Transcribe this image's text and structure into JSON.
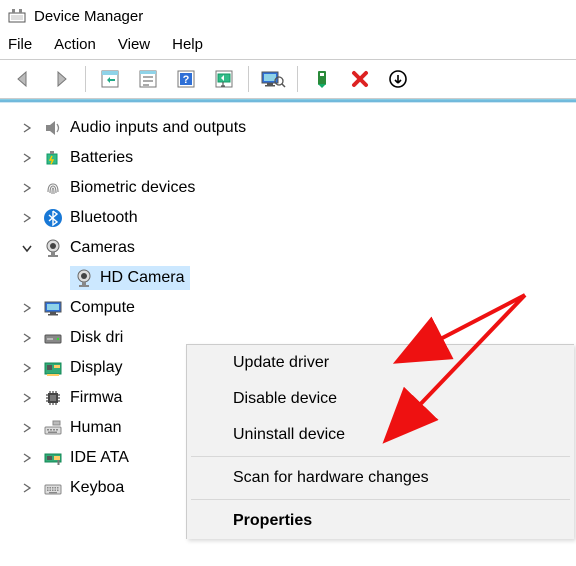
{
  "title": "Device Manager",
  "menu": {
    "file": "File",
    "action": "Action",
    "view": "View",
    "help": "Help"
  },
  "tree": {
    "audio": "Audio inputs and outputs",
    "batteries": "Batteries",
    "biometric": "Biometric devices",
    "bluetooth": "Bluetooth",
    "cameras": "Cameras",
    "hd_camera": "HD Camera",
    "computers": "Compute",
    "disk": "Disk dri",
    "display": "Display",
    "firmware": "Firmwa",
    "hid": "Human",
    "ide": "IDE ATA",
    "keyboards": "Keyboa"
  },
  "ctx": {
    "update": "Update driver",
    "disable": "Disable device",
    "uninstall": "Uninstall device",
    "scan": "Scan for hardware changes",
    "properties": "Properties"
  }
}
